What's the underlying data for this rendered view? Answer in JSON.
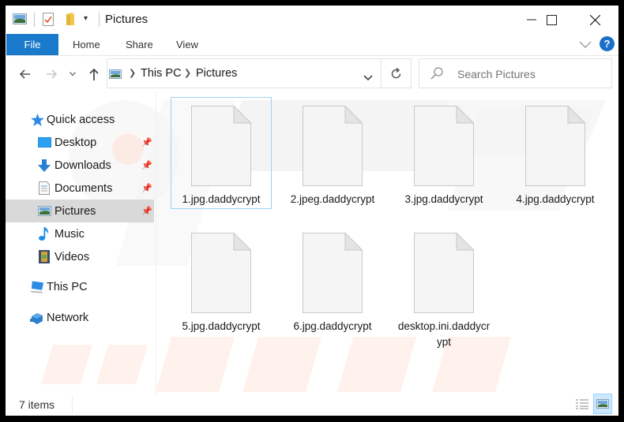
{
  "window": {
    "title": "Pictures",
    "controls": {
      "minimize": "minimize",
      "maximize": "maximize",
      "close": "close"
    }
  },
  "ribbon": {
    "tabs": [
      "File",
      "Home",
      "Share",
      "View"
    ],
    "active_tab": "File",
    "expand_icon": "chevron-down-icon",
    "help_label": "?"
  },
  "navigation": {
    "back": "back-arrow-icon",
    "forward": "forward-arrow-icon",
    "recent": "recent-locations-icon",
    "up": "up-arrow-icon"
  },
  "address_bar": {
    "breadcrumbs": [
      "This PC",
      "Pictures"
    ],
    "refresh": "refresh-icon"
  },
  "search": {
    "placeholder": "Search Pictures"
  },
  "sidebar": {
    "items": [
      {
        "label": "Quick access",
        "icon": "star-icon",
        "pinned": false,
        "selected": false
      },
      {
        "label": "Desktop",
        "icon": "desktop-icon",
        "pinned": true,
        "selected": false
      },
      {
        "label": "Downloads",
        "icon": "download-icon",
        "pinned": true,
        "selected": false
      },
      {
        "label": "Documents",
        "icon": "documents-icon",
        "pinned": true,
        "selected": false
      },
      {
        "label": "Pictures",
        "icon": "pictures-icon",
        "pinned": true,
        "selected": true
      },
      {
        "label": "Music",
        "icon": "music-icon",
        "pinned": false,
        "selected": false
      },
      {
        "label": "Videos",
        "icon": "videos-icon",
        "pinned": false,
        "selected": false
      },
      {
        "label": "This PC",
        "icon": "computer-icon",
        "pinned": false,
        "selected": false
      },
      {
        "label": "Network",
        "icon": "network-icon",
        "pinned": false,
        "selected": false
      }
    ]
  },
  "files": [
    {
      "name": "1.jpg.daddycrypt"
    },
    {
      "name": "2.jpeg.daddycrypt"
    },
    {
      "name": "3.jpg.daddycrypt"
    },
    {
      "name": "4.jpg.daddycrypt"
    },
    {
      "name": "5.jpg.daddycrypt"
    },
    {
      "name": "6.jpg.daddycrypt"
    },
    {
      "name": "desktop.ini.daddycrypt"
    }
  ],
  "status_bar": {
    "item_count": "7 items",
    "views": [
      "details-view",
      "large-icons-view"
    ],
    "active_view": "large-icons-view"
  },
  "colors": {
    "accent": "#1979ca",
    "selection_border": "#9fd2f0",
    "sidebar_selected": "#d9d9d9",
    "help_badge": "#1a6fc9"
  }
}
